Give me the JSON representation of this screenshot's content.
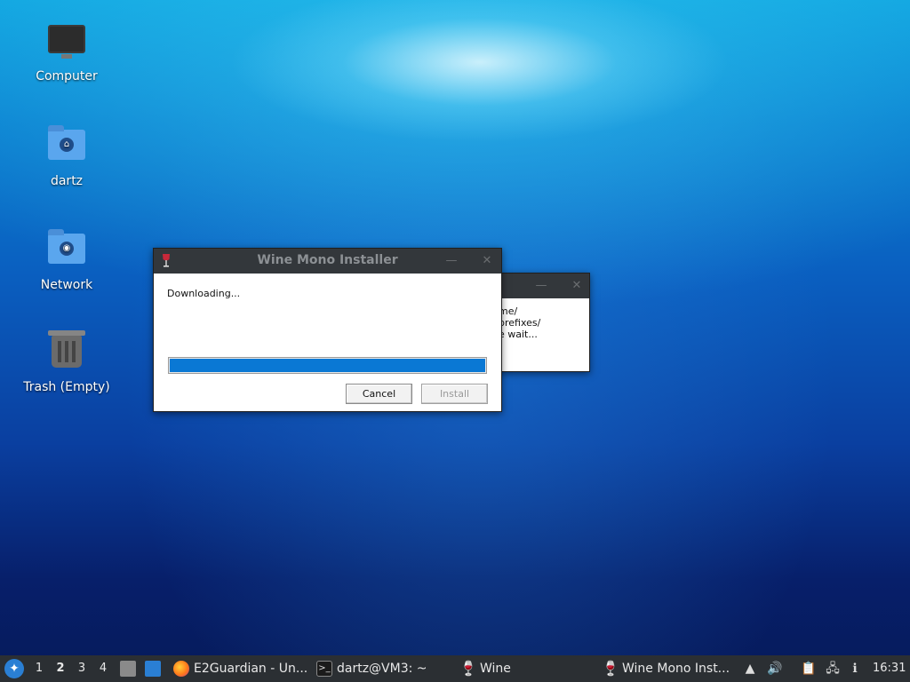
{
  "desktop": {
    "icons": [
      {
        "label": "Computer",
        "icon": "monitor-icon"
      },
      {
        "label": "dartz",
        "icon": "home-folder-icon"
      },
      {
        "label": "Network",
        "icon": "network-folder-icon"
      },
      {
        "label": "Trash (Empty)",
        "icon": "trash-icon"
      }
    ]
  },
  "back_window": {
    "lines": [
      "me/",
      "prefixes/",
      "e wait..."
    ]
  },
  "installer": {
    "title": "Wine Mono Installer",
    "status": "Downloading...",
    "progress_fraction": 1.0,
    "cancel_label": "Cancel",
    "install_label": "Install",
    "minimize_glyph": "—",
    "close_glyph": "✕"
  },
  "taskbar": {
    "workspaces": [
      "1",
      "2",
      "3",
      "4"
    ],
    "active_workspace": "2",
    "tasks": [
      {
        "label": "E2Guardian - Un...",
        "icon": "firefox-icon"
      },
      {
        "label": "dartz@VM3: ~",
        "icon": "terminal-icon"
      },
      {
        "label": "Wine",
        "icon": "wine-icon"
      },
      {
        "label": "Wine Mono Inst...",
        "icon": "wine-icon"
      }
    ],
    "clock": "16:31",
    "accent": "#0a78d4"
  }
}
